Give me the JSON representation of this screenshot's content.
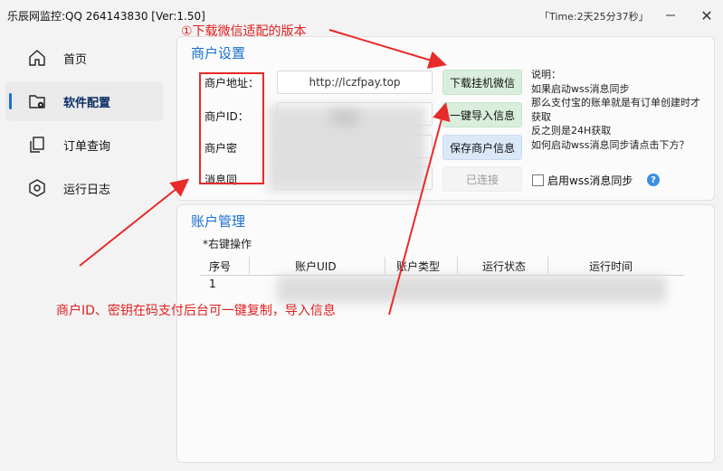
{
  "window": {
    "title": "乐辰网监控:QQ 264143830  [Ver:1.50]",
    "time": "「Time:2天25分37秒」",
    "minimize_icon": "minimize-icon",
    "close_icon": "close-icon",
    "close_label": "✕"
  },
  "sidebar": {
    "items": [
      {
        "label": "首页",
        "icon": "home-icon"
      },
      {
        "label": "软件配置",
        "icon": "folder-settings-icon"
      },
      {
        "label": "订单查询",
        "icon": "copy-icon"
      },
      {
        "label": "运行日志",
        "icon": "hexagon-log-icon"
      }
    ],
    "active_index": 1,
    "accent": "#1e6fd0"
  },
  "merchant": {
    "section_title": "商户设置",
    "fields": {
      "address_label": "商户地址：",
      "address_value": "http://lczfpay.top",
      "id_label": "商户ID：",
      "key_label": "商户密",
      "sync_label": "消息同"
    },
    "buttons": {
      "download": "下载挂机微信",
      "import": "一键导入信息",
      "save": "保存商户信息",
      "connected": "已连接"
    },
    "description": [
      "说明：",
      "如果启动wss消息同步",
      "那么支付宝的账单就是有订单创建时才",
      "获取",
      "反之则是24H获取",
      "如何启动wss消息同步请点击下方？"
    ],
    "checkbox_label": "启用wss消息同步",
    "help_label": "?"
  },
  "account": {
    "section_title": "账户管理",
    "hint": "*右键操作",
    "columns": [
      "序号",
      "账户UID",
      "账户类型",
      "运行状态",
      "运行时间"
    ],
    "rows": [
      [
        "1",
        "",
        "",
        "",
        ""
      ]
    ]
  },
  "annotations": {
    "top_text": "①下载微信适配的版本",
    "bottom_text": "商户ID、密钥在码支付后台可一键复制，导入信息",
    "color": "#e82a2a"
  }
}
